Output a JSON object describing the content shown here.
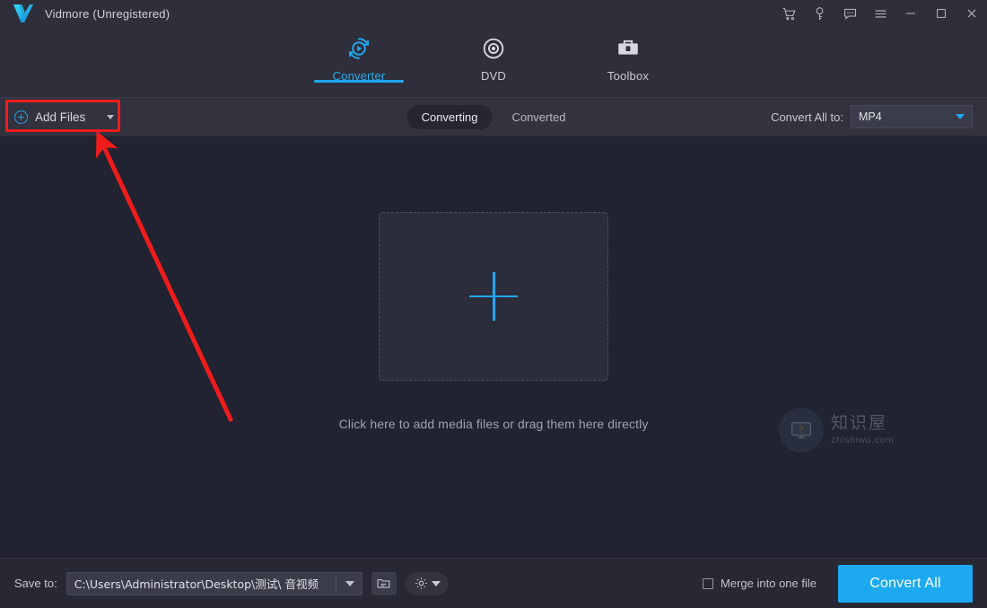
{
  "window": {
    "app_name": "Vidmore (Unregistered)",
    "logo_icon": "vidmore-check-logo",
    "controls": [
      {
        "name": "cart-icon",
        "glyph": "cart"
      },
      {
        "name": "key-icon",
        "glyph": "key"
      },
      {
        "name": "feedback-icon",
        "glyph": "comment"
      },
      {
        "name": "menu-icon",
        "glyph": "hamburger"
      },
      {
        "name": "minimize-icon",
        "glyph": "minimize"
      },
      {
        "name": "maximize-icon",
        "glyph": "maximize"
      },
      {
        "name": "close-icon",
        "glyph": "close"
      }
    ]
  },
  "nav": {
    "tabs": [
      {
        "label": "Converter",
        "icon": "converter-icon",
        "active": true
      },
      {
        "label": "DVD",
        "icon": "dvd-disc-icon",
        "active": false
      },
      {
        "label": "Toolbox",
        "icon": "toolbox-icon",
        "active": false
      }
    ]
  },
  "toolbar": {
    "add_files_label": "Add Files",
    "add_files_icon": "plus-circle-icon",
    "add_files_caret": "chevron-down-icon",
    "segments": [
      {
        "label": "Converting",
        "active": true
      },
      {
        "label": "Converted",
        "active": false
      }
    ],
    "convert_all_to_label": "Convert All to:",
    "format_value": "MP4",
    "format_caret": "chevron-down-icon"
  },
  "canvas": {
    "dropzone_icon": "plus-icon",
    "hint_text": "Click here to add media files or drag them here directly",
    "watermark": {
      "badge_icon": "monitor-question-icon",
      "cn_text": "知识屋",
      "en_text": "zhishiwu.com"
    }
  },
  "bottom": {
    "save_to_label": "Save to:",
    "save_path": "C:\\Users\\Administrator\\Desktop\\测试\\ 音视频",
    "path_caret": "chevron-down-icon",
    "browse_icon": "folder-icon",
    "settings_icon": "gear-icon",
    "settings_caret": "chevron-down-icon",
    "merge_label": "Merge into one file",
    "merge_checked": false,
    "convert_all_label": "Convert All"
  },
  "annotation": {
    "highlight_target": "add-files-button",
    "arrow_color": "#f01c1c",
    "box_color": "#f01c1c"
  },
  "colors": {
    "accent": "#1ea7ef",
    "primary_button": "#1ca9f0",
    "header_bg": "#2e2f3b",
    "toolbar_bg": "#32333f",
    "canvas_bg": "#212330",
    "bottom_bg": "#272834",
    "annotation_red": "#f01c1c"
  }
}
